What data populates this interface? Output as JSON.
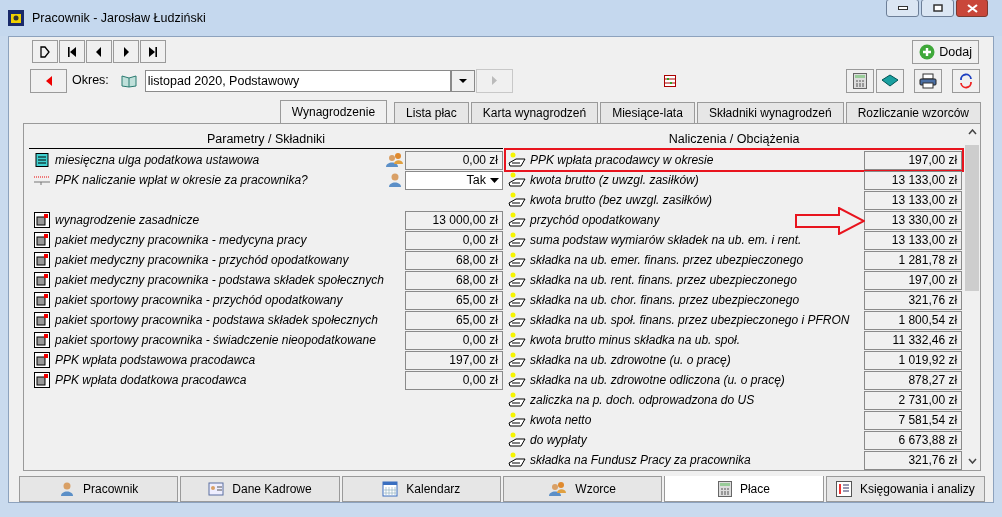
{
  "window": {
    "title": "Pracownik - Jarosław Łudziński"
  },
  "add_button": "Dodaj",
  "period": {
    "label": "Okres:",
    "value": "listopad 2020, Podstawowy"
  },
  "tabs": [
    {
      "label": "Wynagrodzenie",
      "selected": true
    },
    {
      "label": "Lista płac",
      "selected": false
    },
    {
      "label": "Karta wynagrodzeń",
      "selected": false
    },
    {
      "label": "Miesiące-lata",
      "selected": false
    },
    {
      "label": "Składniki wynagrodzeń",
      "selected": false
    },
    {
      "label": "Rozliczanie wzorców",
      "selected": false
    }
  ],
  "parameters": {
    "heading": "Parametry / Składniki",
    "rows": [
      {
        "kind": "relief",
        "label": "miesięczna ulga podatkowa ustawowa",
        "value": "0,00 zł"
      },
      {
        "kind": "choice",
        "label": "PPK naliczanie wpłat w okresie za pracownika?",
        "value": "Tak"
      },
      {
        "kind": "component",
        "label": "wynagrodzenie zasadnicze",
        "value": "13 000,00 zł"
      },
      {
        "kind": "component",
        "label": "pakiet medyczny pracownika - medycyna pracy",
        "value": "0,00 zł"
      },
      {
        "kind": "component",
        "label": "pakiet medyczny pracownika - przychód opodatkowany",
        "value": "68,00 zł"
      },
      {
        "kind": "component",
        "label": "pakiet medyczny pracownika - podstawa składek społecznych",
        "value": "68,00 zł"
      },
      {
        "kind": "component",
        "label": "pakiet sportowy pracownika - przychód opodatkowany",
        "value": "65,00 zł"
      },
      {
        "kind": "component",
        "label": "pakiet sportowy pracownika - podstawa składek społecznych",
        "value": "65,00 zł"
      },
      {
        "kind": "component",
        "label": "pakiet sportowy pracownika - świadczenie nieopodatkowane",
        "value": "0,00 zł"
      },
      {
        "kind": "component",
        "label": "PPK wpłata podstawowa pracodawca",
        "value": "197,00 zł"
      },
      {
        "kind": "component",
        "label": "PPK wpłata dodatkowa pracodawca",
        "value": "0,00 zł"
      }
    ]
  },
  "charges": {
    "heading": "Naliczenia / Obciążenia",
    "rows": [
      {
        "label": "PPK wpłata pracodawcy w okresie",
        "value": "197,00 zł",
        "highlighted": true,
        "arrow": false
      },
      {
        "label": "kwota brutto (z uwzgl. zasiłków)",
        "value": "13 133,00 zł",
        "highlighted": false,
        "arrow": false
      },
      {
        "label": "kwota brutto (bez uwzgl. zasiłków)",
        "value": "13 133,00 zł",
        "highlighted": false,
        "arrow": false
      },
      {
        "label": "przychód opodatkowany",
        "value": "13 330,00 zł",
        "highlighted": false,
        "arrow": true
      },
      {
        "label": "suma podstaw wymiarów składek na ub. em. i rent.",
        "value": "13 133,00 zł",
        "highlighted": false,
        "arrow": false
      },
      {
        "label": "składka na ub. emer. finans. przez ubezpieczonego",
        "value": "1 281,78 zł",
        "highlighted": false,
        "arrow": false
      },
      {
        "label": "składka na ub. rent. finans. przez ubezpieczonego",
        "value": "197,00 zł",
        "highlighted": false,
        "arrow": false
      },
      {
        "label": "składka na ub. chor. finans. przez ubezpieczonego",
        "value": "321,76 zł",
        "highlighted": false,
        "arrow": false
      },
      {
        "label": "składka na ub. społ. finans. przez ubezpieczonego i PFRON",
        "value": "1 800,54 zł",
        "highlighted": false,
        "arrow": false
      },
      {
        "label": "kwota brutto minus składka na ub. społ.",
        "value": "11 332,46 zł",
        "highlighted": false,
        "arrow": false
      },
      {
        "label": "składka na ub. zdrowotne (u. o pracę)",
        "value": "1 019,92 zł",
        "highlighted": false,
        "arrow": false
      },
      {
        "label": "składka na ub. zdrowotne odliczona (u. o pracę)",
        "value": "878,27 zł",
        "highlighted": false,
        "arrow": false
      },
      {
        "label": "zaliczka na p. doch. odprowadzona do US",
        "value": "2 731,00 zł",
        "highlighted": false,
        "arrow": false
      },
      {
        "label": "kwota netto",
        "value": "7 581,54 zł",
        "highlighted": false,
        "arrow": false
      },
      {
        "label": "do wypłaty",
        "value": "6 673,88 zł",
        "highlighted": false,
        "arrow": false
      },
      {
        "label": "składka na Fundusz Pracy za pracownika",
        "value": "321,76 zł",
        "highlighted": false,
        "arrow": false
      }
    ]
  },
  "bottom_tabs": [
    {
      "label": "Pracownik",
      "selected": false
    },
    {
      "label": "Dane Kadrowe",
      "selected": false
    },
    {
      "label": "Kalendarz",
      "selected": false
    },
    {
      "label": "Wzorce",
      "selected": false
    },
    {
      "label": "Płace",
      "selected": true
    },
    {
      "label": "Księgowania i analizy",
      "selected": false
    }
  ]
}
